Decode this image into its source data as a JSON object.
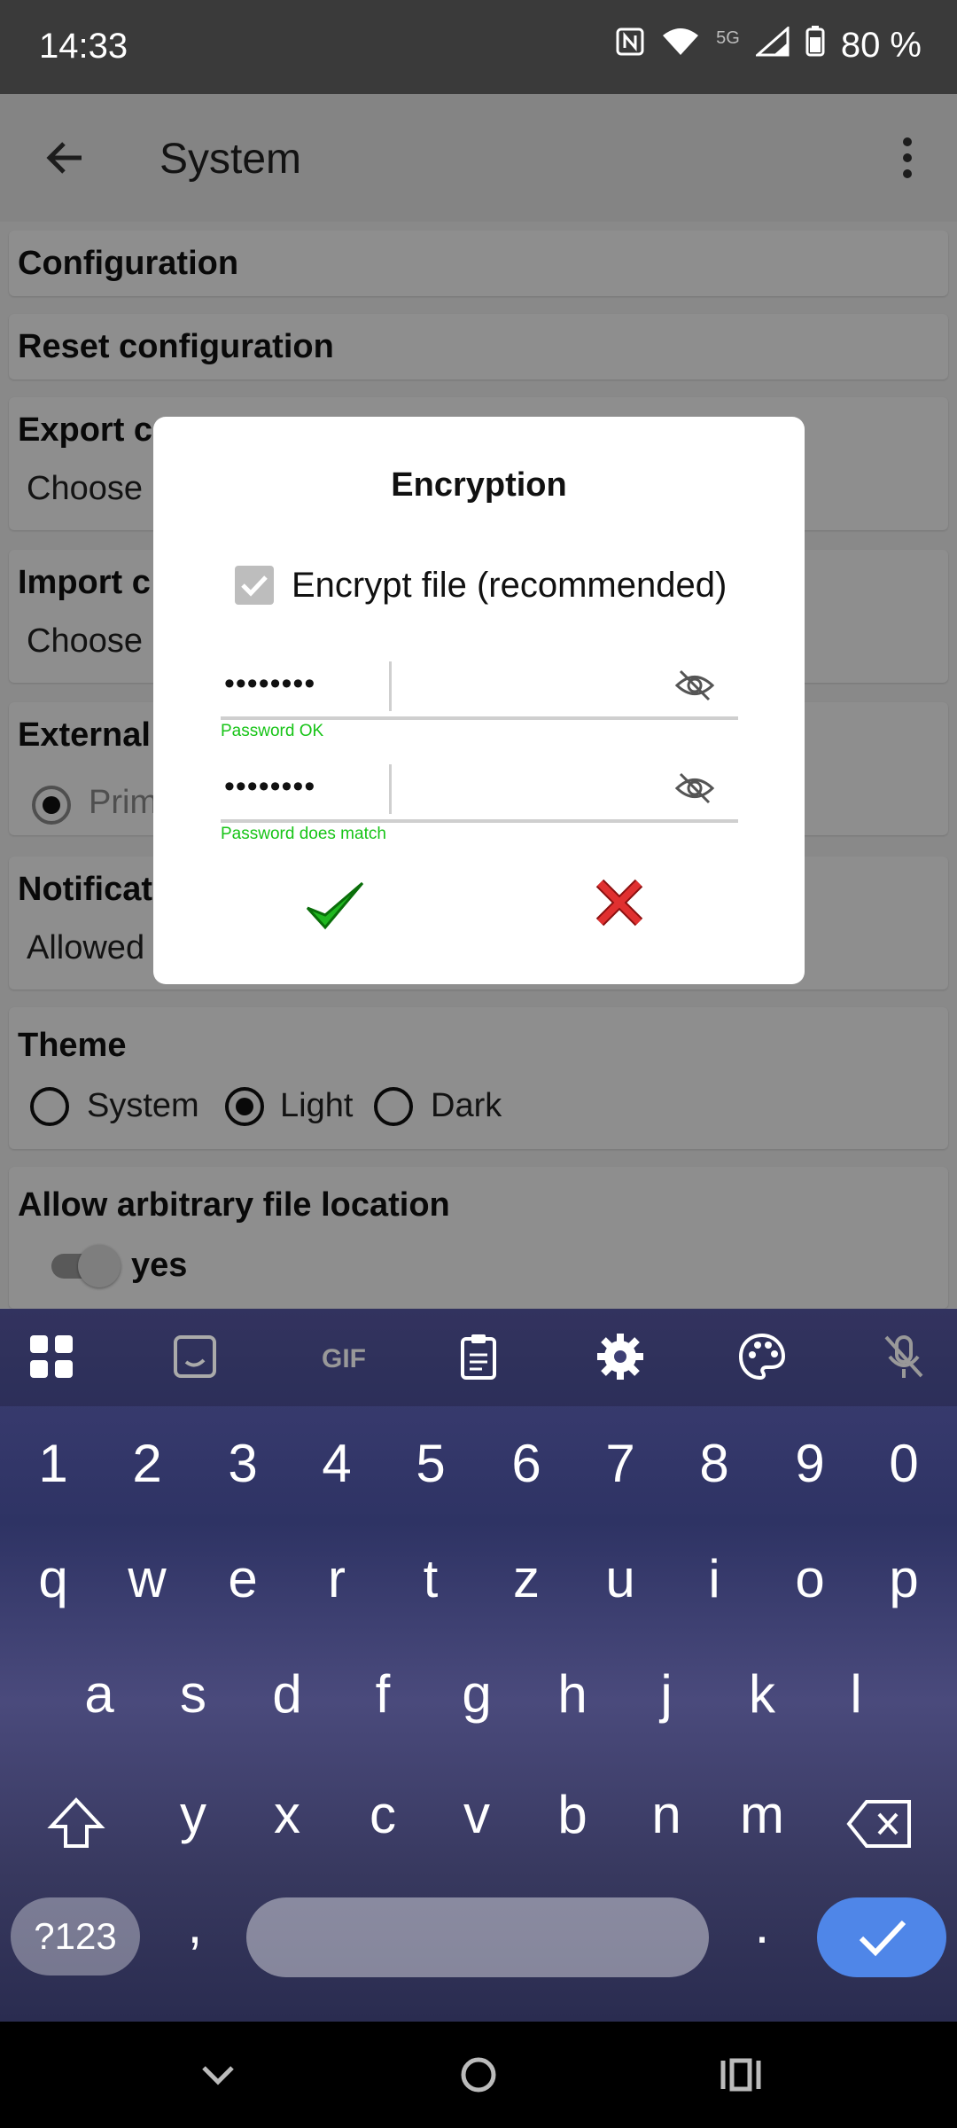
{
  "status_bar": {
    "time": "14:33",
    "network": "5G",
    "battery": "80 %"
  },
  "app_bar": {
    "title": "System"
  },
  "settings": {
    "configuration": "Configuration",
    "reset_configuration": "Reset configuration",
    "export_title": "Export c",
    "export_sub": "Choose",
    "import_title": "Import c",
    "import_sub": "Choose",
    "external_title": "External",
    "external_option": "Prim",
    "notifications_title": "Notificat",
    "notifications_sub": "Allowed",
    "theme_title": "Theme",
    "theme_options": [
      "System",
      "Light",
      "Dark"
    ],
    "theme_selected": "Light",
    "arbitrary_title": "Allow arbitrary file location",
    "arbitrary_value": "yes"
  },
  "dialog": {
    "title": "Encryption",
    "encrypt_label": "Encrypt file (recommended)",
    "password1_masked": "••••••••",
    "password1_hint": "Password OK",
    "password2_masked": "••••••••",
    "password2_hint": "Password does match"
  },
  "keyboard": {
    "numbers": [
      "1",
      "2",
      "3",
      "4",
      "5",
      "6",
      "7",
      "8",
      "9",
      "0"
    ],
    "row1": [
      "q",
      "w",
      "e",
      "r",
      "t",
      "z",
      "u",
      "i",
      "o",
      "p"
    ],
    "row2": [
      "a",
      "s",
      "d",
      "f",
      "g",
      "h",
      "j",
      "k",
      "l"
    ],
    "row3": [
      "y",
      "x",
      "c",
      "v",
      "b",
      "n",
      "m"
    ],
    "symbols_key": "?123",
    "comma_key": ",",
    "period_key": "."
  },
  "colors": {
    "accent_green": "#17c417",
    "cancel_red": "#e03030",
    "enter_blue": "#4f86e8"
  }
}
